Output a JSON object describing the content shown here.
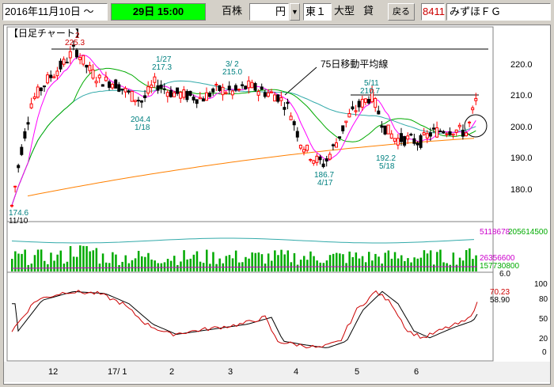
{
  "toolbar": {
    "date_text": "2016年11月10日 ～",
    "period_text": "29日 15:00",
    "unit_label": "百株",
    "currency_value": "円",
    "market_value": "東１",
    "size_label": "大型",
    "lending_label": "貸",
    "back_button": "戻る",
    "code_value": "8411",
    "name_value": "みずほＦＧ"
  },
  "chart": {
    "title": "【日足チャート】",
    "ma_annotation": "75日移動平均線",
    "price_labels": [
      {
        "value": "220.0"
      },
      {
        "value": "210.0"
      },
      {
        "value": "200.0"
      },
      {
        "value": "190.0"
      },
      {
        "value": "180.0"
      }
    ],
    "point_annotations": [
      {
        "text": "2",
        "color": "#cc0000"
      },
      {
        "text": "225.3",
        "color": "#cc0000"
      },
      {
        "text": "1/27",
        "color": "#008080"
      },
      {
        "text": "217.3",
        "color": "#008080"
      },
      {
        "text": "3/ 2",
        "color": "#008080"
      },
      {
        "text": "215.0",
        "color": "#008080"
      },
      {
        "text": "204.4",
        "color": "#008080"
      },
      {
        "text": "1/18",
        "color": "#008080"
      },
      {
        "text": "5/11",
        "color": "#008080"
      },
      {
        "text": "210.7",
        "color": "#008080"
      },
      {
        "text": "192.2",
        "color": "#008080"
      },
      {
        "text": "5/18",
        "color": "#008080"
      },
      {
        "text": "186.7",
        "color": "#008080"
      },
      {
        "text": "4/17",
        "color": "#008080"
      },
      {
        "text": "174.6",
        "color": "#008080"
      },
      {
        "text": "11/10",
        "color": "#000000"
      }
    ],
    "volume_labels": {
      "top_a": "5118678",
      "top_b": "205614500",
      "mid": "26356600",
      "mid_b": "157730800",
      "low": "6.0"
    },
    "osc_labels": {
      "val_a": "70.23",
      "val_b": "58.90",
      "ticks": [
        "100",
        "80",
        "50",
        "20",
        "0"
      ]
    },
    "x_ticks": [
      "12",
      "17/ 1",
      "2",
      "3",
      "4",
      "5",
      "6"
    ]
  },
  "colors": {
    "accent_green": "#00ff00",
    "candle_up": "#ff0000",
    "candle_down": "#000000",
    "ma_short": "#ff00ff",
    "ma_mid": "#00aa00",
    "ma_long": "#33aaaa",
    "ma_75": "#ff8000",
    "volume": "#00aa00"
  }
}
